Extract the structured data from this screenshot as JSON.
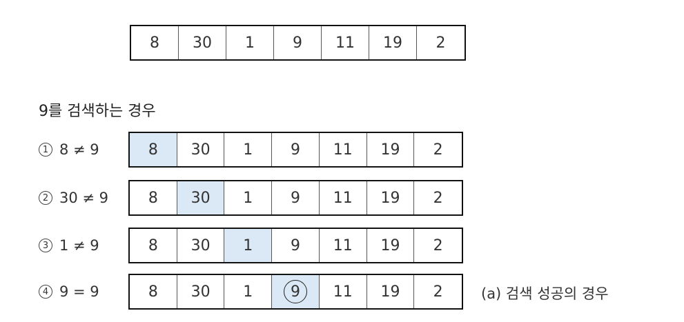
{
  "top_array": [
    "8",
    "30",
    "1",
    "9",
    "11",
    "19",
    "2"
  ],
  "title": "9를 검색하는 경우",
  "steps": [
    {
      "num": "1",
      "expr": "8 ≠ 9",
      "values": [
        "8",
        "30",
        "1",
        "9",
        "11",
        "19",
        "2"
      ],
      "highlight": 0,
      "circled": null
    },
    {
      "num": "2",
      "expr": "30 ≠ 9",
      "values": [
        "8",
        "30",
        "1",
        "9",
        "11",
        "19",
        "2"
      ],
      "highlight": 1,
      "circled": null
    },
    {
      "num": "3",
      "expr": "1 ≠ 9",
      "values": [
        "8",
        "30",
        "1",
        "9",
        "11",
        "19",
        "2"
      ],
      "highlight": 2,
      "circled": null
    },
    {
      "num": "4",
      "expr": "9 = 9",
      "values": [
        "8",
        "30",
        "1",
        "9",
        "11",
        "19",
        "2"
      ],
      "highlight": 3,
      "circled": 3
    }
  ],
  "caption": "(a) 검색 성공의 경우",
  "colors": {
    "highlight": "#dbe8f5",
    "border": "#111111"
  }
}
